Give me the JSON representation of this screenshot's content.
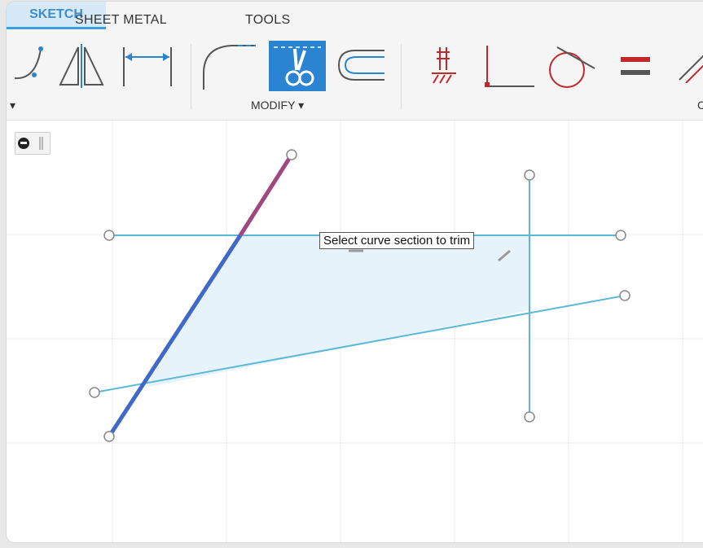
{
  "tabs": [
    {
      "label": "SHEET METAL"
    },
    {
      "label": "TOOLS"
    },
    {
      "label": "SKETCH"
    }
  ],
  "toolbar": {
    "modify_label": "MODIFY",
    "modify_dropdown_glyph": "▾",
    "partial_label_right": "C",
    "partial_label_left": "▾",
    "active_tool": "trim-scissors-icon"
  },
  "tooltip": {
    "text": "Select curve section to trim"
  },
  "colors": {
    "accent": "#2b84d1",
    "sketch_line": "#5bb8d6",
    "selected_line": "#3f68c8",
    "highlight_segment": "#a1467e",
    "profile_fill": "#e4f2fb",
    "constraint_red": "#c0282c"
  },
  "icons": [
    "spline-icon",
    "mirror-icon",
    "dimension-icon",
    "fillet-icon",
    "trim-scissors-icon",
    "offset-icon",
    "fix-constraint-icon",
    "perpendicular-icon",
    "tangent-icon",
    "equal-icon",
    "parallel-icon",
    "view-toggle-icon"
  ]
}
